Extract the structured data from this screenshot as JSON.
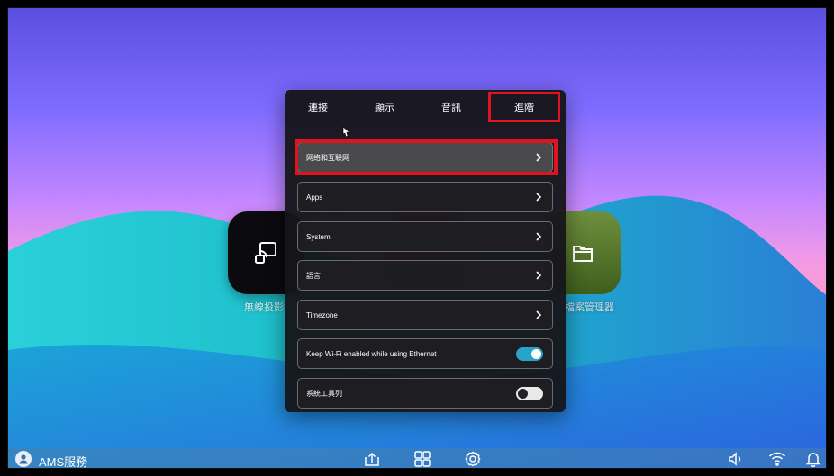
{
  "colors": {
    "accent": "#e0141e",
    "toggle_on": "#2aa3c9",
    "panel": "#16161a"
  },
  "tabs": [
    {
      "label": "連接"
    },
    {
      "label": "顯示"
    },
    {
      "label": "音訊"
    },
    {
      "label": "進階",
      "active": true
    }
  ],
  "settings": {
    "rows": [
      {
        "label": "网络和互联网",
        "control": "chevron"
      },
      {
        "label": "Apps",
        "control": "chevron"
      },
      {
        "label": "System",
        "control": "chevron"
      },
      {
        "label": "語言",
        "control": "chevron"
      },
      {
        "label": "Timezone",
        "control": "chevron"
      },
      {
        "label": "Keep Wi-Fi enabled while using Ethernet",
        "control": "toggle",
        "state": "on"
      },
      {
        "label": "系統工具列",
        "control": "toggle",
        "state": "off"
      }
    ]
  },
  "home": {
    "tiles": [
      {
        "label": "無線投影",
        "icon": "screen-cast-icon"
      },
      {
        "label": "檔案管理器",
        "icon": "folder-icon"
      }
    ]
  },
  "taskbar": {
    "user_label": "AMS服務",
    "icons": [
      "avatar-icon",
      "upload-icon",
      "apps-grid-icon",
      "settings-gear-icon",
      "volume-icon",
      "wifi-icon",
      "bell-icon"
    ]
  }
}
